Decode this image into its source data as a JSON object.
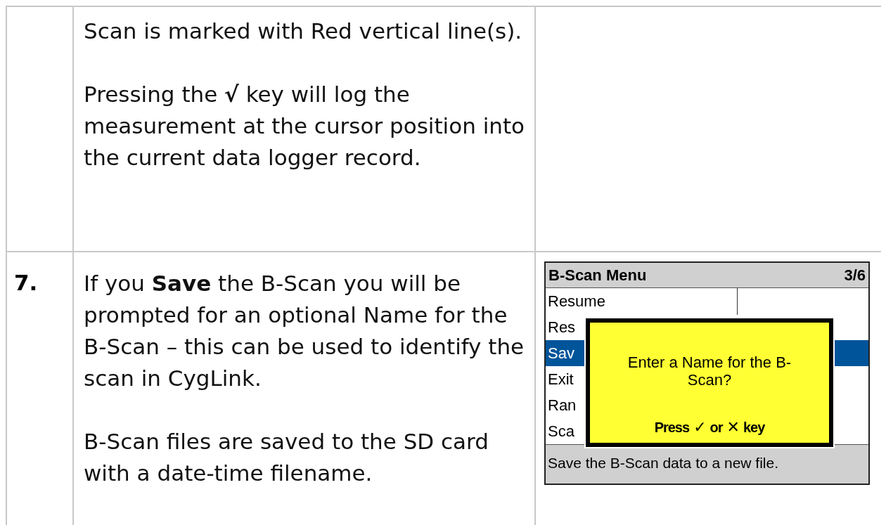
{
  "rows": [
    {
      "step": "",
      "paragraphs": [
        "Scan is marked with Red vertical line(s).",
        "Pressing the **√** key will log the measurement at the cursor position into the current data logger record."
      ],
      "device": null
    },
    {
      "step": "7.",
      "paragraphs": [
        "If you **Save** the B-Scan you will be prompted for an optional Name for the B-Scan – this can be used to identify the scan in CygLink.",
        "B-Scan files are saved to the SD card with a date-time filename."
      ],
      "device": {
        "title": "B-Scan Menu",
        "page": "3/6",
        "menu_items": [
          {
            "label": "Resume",
            "selected": false
          },
          {
            "label": "Res",
            "selected": false
          },
          {
            "label": "Sav",
            "selected": true
          },
          {
            "label": "Exit",
            "selected": false
          },
          {
            "label": "Ran",
            "selected": false
          },
          {
            "label": "Sca",
            "selected": false
          }
        ],
        "dialog": {
          "message": "Enter a Name for the B-Scan?",
          "hint": "Press",
          "ok_key": "✓",
          "or": "or",
          "cancel_key": "✕",
          "key_word": "key"
        },
        "help": "Save the B-Scan data to a new file."
      }
    }
  ]
}
